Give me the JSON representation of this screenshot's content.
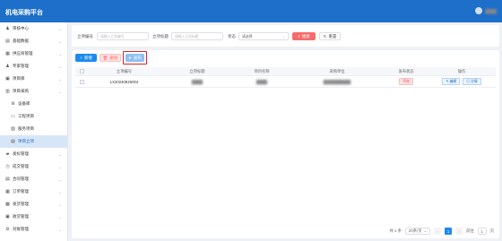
{
  "header": {
    "title": "机电采购平台",
    "user_name": "████"
  },
  "sidebar": {
    "items": [
      {
        "label": "审核中心",
        "icon": "person-icon",
        "glyph": "♟"
      },
      {
        "label": "基础数据",
        "icon": "chart-icon",
        "glyph": "▤"
      },
      {
        "label": "供应商管理",
        "icon": "grid-icon",
        "glyph": "▦"
      },
      {
        "label": "专家管理",
        "icon": "person-icon",
        "glyph": "♟"
      },
      {
        "label": "项目库",
        "icon": "box-icon",
        "glyph": "▣"
      },
      {
        "label": "项目采购",
        "icon": "list-icon",
        "glyph": "▥"
      },
      {
        "label": "设备库",
        "icon": "gear-icon",
        "glyph": "⚙",
        "sub": true
      },
      {
        "label": "工程项目",
        "icon": "briefcase-icon",
        "glyph": "▭",
        "sub": true
      },
      {
        "label": "服务项目",
        "icon": "service-icon",
        "glyph": "▨",
        "sub": true
      },
      {
        "label": "项目立项",
        "icon": "document-icon",
        "glyph": "▤",
        "sub": true,
        "active": true
      },
      {
        "label": "发标管理",
        "icon": "folder-icon",
        "glyph": "▰"
      },
      {
        "label": "成交管理",
        "icon": "clock-icon",
        "glyph": "◷"
      },
      {
        "label": "合同管理",
        "icon": "contract-icon",
        "glyph": "▤"
      },
      {
        "label": "订单管理",
        "icon": "grid-icon",
        "glyph": "▦"
      },
      {
        "label": "发货管理",
        "icon": "truck-icon",
        "glyph": "▩"
      },
      {
        "label": "收货管理",
        "icon": "inbox-icon",
        "glyph": "▣"
      },
      {
        "label": "对账管理",
        "icon": "gear-icon",
        "glyph": "⚙"
      }
    ]
  },
  "search": {
    "fields": [
      {
        "label": "立项编号",
        "placeholder": "请输入立项编号"
      },
      {
        "label": "立项标题",
        "placeholder": "请输入立项标题"
      }
    ],
    "status_label": "状态",
    "status_value": "请选择",
    "search_label": "搜索",
    "reset_label": "重置"
  },
  "toolbar": {
    "add_label": "新增",
    "delete_label": "删除",
    "publish_label": "发布"
  },
  "table": {
    "columns": [
      "立项编号",
      "立项标题",
      "项目名称",
      "采购单位",
      "发布状态",
      "操作"
    ],
    "rows": [
      {
        "code": "LX20240926004",
        "title": "████",
        "project": "████",
        "unit": "██████████",
        "status": "草稿",
        "edit": "编辑",
        "detail": "详情"
      }
    ]
  },
  "pagination": {
    "total_text": "共 1 条",
    "page_size": "20条/页",
    "current_page": "1",
    "goto_label": "前往",
    "goto_value": "1",
    "page_suffix": "页"
  },
  "colors": {
    "brand": "#1d6fc9",
    "danger": "#f56c6c",
    "primary": "#1d89f0",
    "highlight": "#e02020"
  }
}
